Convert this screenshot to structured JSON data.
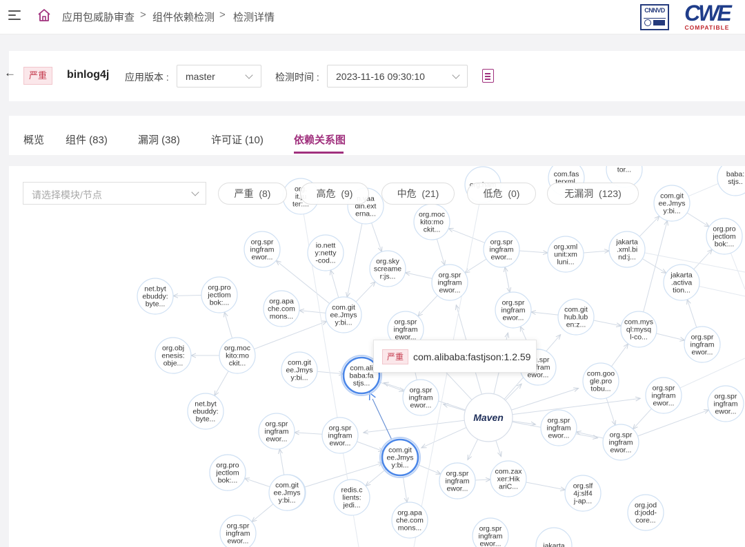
{
  "breadcrumb": {
    "items": [
      "应用包威胁审查",
      "组件依赖检测",
      "检测详情"
    ],
    "separator": ">"
  },
  "logos": {
    "cnnvd": "CNNVD",
    "cwe": "CWE",
    "cwe_sub": "COMPATIBLE"
  },
  "header": {
    "severity": "严重",
    "project_name": "binlog4j",
    "version_label": "应用版本 :",
    "version_value": "master",
    "time_label": "检测时间 :",
    "time_value": "2023-11-16 09:30:10"
  },
  "tabs": [
    {
      "label": "概览",
      "active": false
    },
    {
      "label": "组件 (83)",
      "active": false
    },
    {
      "label": "漏洞 (38)",
      "active": false
    },
    {
      "label": "许可证 (10)",
      "active": false
    },
    {
      "label": "依赖关系图",
      "active": true
    }
  ],
  "graph": {
    "module_select_placeholder": "请选择模块/节点",
    "filters": [
      {
        "label": "严重",
        "count": "8"
      },
      {
        "label": "高危",
        "count": "9"
      },
      {
        "label": "中危",
        "count": "21"
      },
      {
        "label": "低危",
        "count": "0"
      },
      {
        "label": "无漏洞",
        "count": "123"
      }
    ],
    "tooltip": {
      "severity": "严重",
      "component": "com.alibaba:fastjson:1.2.59"
    },
    "root_label": "Maven",
    "nodes": [
      {
        "id": "n1",
        "lines": [
          "org.pro",
          "jectlom",
          "bok:..."
        ]
      },
      {
        "id": "n2",
        "lines": [
          "org.jod",
          "d:jodd-",
          "core..."
        ]
      },
      {
        "id": "n3",
        "lines": [
          "jakarta",
          ".activa",
          "tion..."
        ]
      },
      {
        "id": "n4",
        "lines": [
          "com.git",
          "ee.Jmys",
          "y:bi..."
        ]
      },
      {
        "id": "n5",
        "lines": [
          "com.ali",
          "baba:fa",
          "stjs..."
        ]
      },
      {
        "id": "n6",
        "lines": [
          "org.spr",
          "ingfram",
          "ewor..."
        ]
      },
      {
        "id": "n7",
        "lines": [
          "org.spr",
          "ingfram",
          "ewor..."
        ]
      },
      {
        "id": "n8",
        "lines": [
          "org.spr",
          "ingfram",
          "ewor..."
        ]
      },
      {
        "id": "n9",
        "lines": [
          "net.byt",
          "ebuddy:",
          "byte..."
        ]
      },
      {
        "id": "n10",
        "lines": [
          "org.pro",
          "jectlom",
          "bok:..."
        ]
      },
      {
        "id": "n11",
        "lines": [
          "org.obj",
          "enesis:",
          "obje..."
        ]
      },
      {
        "id": "n12",
        "lines": [
          "org.moc",
          "kito:mo",
          "ckit..."
        ]
      },
      {
        "id": "n13",
        "lines": [
          "net.byt",
          "ebuddy:",
          "byte..."
        ]
      },
      {
        "id": "n14",
        "lines": [
          "org.spr",
          "ingfram",
          "ewor..."
        ]
      },
      {
        "id": "n15",
        "lines": [
          "io.nett",
          "y:netty",
          "-cod..."
        ]
      },
      {
        "id": "n16",
        "lines": [
          "org.apa",
          "che.com",
          "mons..."
        ]
      },
      {
        "id": "n17",
        "lines": [
          "com.git",
          "ee.Jmys",
          "y:bi..."
        ]
      },
      {
        "id": "n18",
        "lines": [
          "com.git",
          "ee.Jmys",
          "y:bi..."
        ]
      },
      {
        "id": "n19",
        "lines": [
          "n.vaa",
          "din.ext",
          "erna..."
        ]
      },
      {
        "id": "n20",
        "lines": [
          "org.moc",
          "kito:mo",
          "ckit..."
        ]
      },
      {
        "id": "n21",
        "lines": [
          "org.sky",
          "screame",
          "r:js..."
        ]
      },
      {
        "id": "n22",
        "lines": [
          "org.spr",
          "ingfram",
          "ewor..."
        ]
      },
      {
        "id": "n23",
        "lines": [
          "org.spr",
          "ingfram",
          "ewor..."
        ]
      },
      {
        "id": "n24",
        "lines": [
          "org.spr",
          "ingfram",
          "ewor..."
        ]
      },
      {
        "id": "n25",
        "lines": [
          "org.spr",
          "ingfram",
          "ewor..."
        ]
      },
      {
        "id": "n26",
        "lines": [
          "org.xml",
          "unit:xm",
          "luni..."
        ]
      },
      {
        "id": "n27",
        "lines": [
          "jakarta",
          ".xml.bi",
          "nd:j..."
        ]
      },
      {
        "id": "n28",
        "lines": [
          "com.git",
          "hub.lub",
          "en:z..."
        ]
      },
      {
        "id": "n29",
        "lines": [
          "com.mys",
          "ql:mysq",
          "l-co..."
        ]
      },
      {
        "id": "n30",
        "lines": [
          "com.git",
          "ee.Jmys",
          "y:bi..."
        ]
      },
      {
        "id": "n31",
        "lines": [
          "org.pro",
          "jectlom",
          "bok:..."
        ]
      },
      {
        "id": "n32",
        "lines": [
          "org.spr",
          "ingfram",
          "ewor..."
        ]
      },
      {
        "id": "n33",
        "lines": [
          "org.spr",
          "ingfram",
          "ewor..."
        ]
      },
      {
        "id": "n34",
        "lines": [
          "com.goo",
          "gle.pro",
          "tobu..."
        ]
      },
      {
        "id": "n35",
        "lines": [
          "org.spr",
          "ingfram",
          "ewor..."
        ]
      },
      {
        "id": "n36",
        "lines": [
          "org.spr",
          "ingfram",
          "ewor..."
        ]
      },
      {
        "id": "n37",
        "lines": [
          "org.spr",
          "ingfram",
          "ewor..."
        ]
      },
      {
        "id": "n38",
        "lines": [
          "org.spr",
          "ingfram",
          "ewor..."
        ]
      },
      {
        "id": "n39",
        "lines": [
          "com.goo",
          "gle.pro",
          "tobu..."
        ]
      },
      {
        "id": "n40",
        "lines": [
          "org.spr",
          "ingfram",
          "ewor..."
        ]
      },
      {
        "id": "n41",
        "lines": [
          "org.pro",
          "jectlom",
          "bok:..."
        ]
      },
      {
        "id": "n42",
        "lines": [
          "com.git",
          "ee.Jmys",
          "y:bi..."
        ]
      },
      {
        "id": "n43",
        "lines": [
          "redis.c",
          "lients:",
          "jedi..."
        ]
      },
      {
        "id": "n44",
        "lines": [
          "org.apa",
          "che.com",
          "mons..."
        ]
      },
      {
        "id": "n45",
        "lines": [
          "org.spr",
          "ingfram",
          "ewor..."
        ]
      },
      {
        "id": "n46",
        "lines": [
          "org.spr",
          "ingfram",
          "ewor..."
        ]
      },
      {
        "id": "n47",
        "lines": [
          "com.zax",
          "xer:Hik",
          "ariC..."
        ]
      },
      {
        "id": "n48",
        "lines": [
          "org.slf",
          "4j:slf4",
          "j-ap..."
        ]
      },
      {
        "id": "n49",
        "lines": [
          "org.spr",
          "ingfram",
          "ewor..."
        ]
      },
      {
        "id": "n50",
        "lines": [
          "com.fas",
          "terxml.",
          ""
        ]
      },
      {
        "id": "n51",
        "lines": [
          "org.ham",
          "",
          ""
        ]
      },
      {
        "id": "n52",
        "lines": [
          "baba:",
          "stjs..",
          ""
        ]
      },
      {
        "id": "n53",
        "lines": [
          "org.",
          "it.ju",
          "ter:..."
        ]
      },
      {
        "id": "n54",
        "lines": [
          "jakarta",
          "",
          ""
        ]
      },
      {
        "id": "n55",
        "lines": [
          "tor...",
          "",
          ""
        ]
      }
    ]
  },
  "colors": {
    "accent": "#a0307d",
    "critical_text": "#c43b4d",
    "critical_bg": "#fbe7ea",
    "node_border": "#cfe0f3",
    "node_highlight": "#4a86e8",
    "edge": "#d3dbe6",
    "highlight_edge": "#6b93d6",
    "maven_text": "#1f2f5a",
    "maven_accent": "#d9442b"
  }
}
